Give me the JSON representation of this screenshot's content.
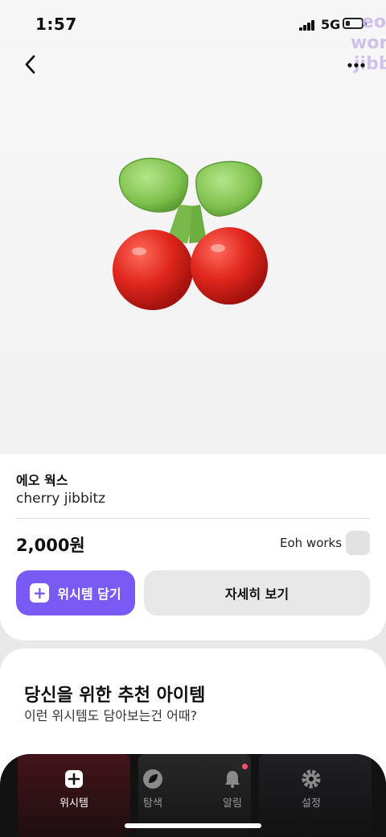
{
  "status_bar": {
    "time": "1:57",
    "network": "5G"
  },
  "header": {
    "back_icon": "chevron-left-icon",
    "more_icon": "more-dots-icon"
  },
  "watermark": {
    "text": "eo works jibbitz"
  },
  "product": {
    "brand": "에오 웍스",
    "name": "cherry jibbitz",
    "price": "2,000원",
    "seller": "Eoh works"
  },
  "actions": {
    "wishlist_label": "위시템 담기",
    "detail_label": "자세히 보기"
  },
  "recommend": {
    "title": "당신을 위한 추천 아이템",
    "subtitle": "이런 위시템도 담아보는건 어때?"
  },
  "nav": {
    "items": [
      {
        "label": "위시템",
        "icon": "plus-square-icon",
        "active": true
      },
      {
        "label": "탐색",
        "icon": "leaf-icon",
        "active": false
      },
      {
        "label": "알림",
        "icon": "bell-icon",
        "active": false,
        "badge": true
      },
      {
        "label": "설정",
        "icon": "gear-icon",
        "active": false
      }
    ]
  },
  "colors": {
    "accent": "#7a5af5",
    "badge": "#ff4d6d",
    "nav_bg": "#121212"
  }
}
